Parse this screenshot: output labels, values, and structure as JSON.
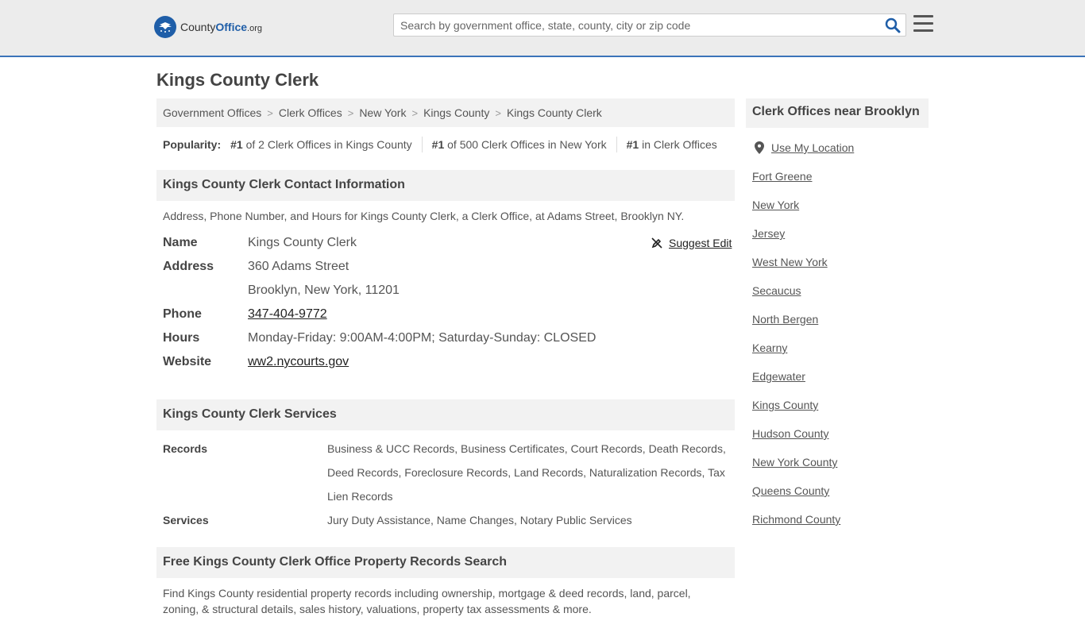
{
  "header": {
    "logo_county": "County",
    "logo_office": "Office",
    "logo_org": ".org",
    "search_placeholder": "Search by government office, state, county, city or zip code"
  },
  "page_title": "Kings County Clerk",
  "breadcrumb": [
    "Government Offices",
    "Clerk Offices",
    "New York",
    "Kings County",
    "Kings County Clerk"
  ],
  "popularity": {
    "label": "Popularity:",
    "items": [
      {
        "rank": "#1",
        "text": " of 2 Clerk Offices in Kings County"
      },
      {
        "rank": "#1",
        "text": " of 500 Clerk Offices in New York"
      },
      {
        "rank": "#1",
        "text": " in Clerk Offices"
      }
    ]
  },
  "contact": {
    "heading": "Kings County Clerk Contact Information",
    "description": "Address, Phone Number, and Hours for Kings County Clerk, a Clerk Office, at Adams Street, Brooklyn NY.",
    "name_label": "Name",
    "name": "Kings County Clerk",
    "address_label": "Address",
    "address_line1": "360 Adams Street",
    "address_line2": "Brooklyn, New York, 11201",
    "phone_label": "Phone",
    "phone": "347-404-9772",
    "hours_label": "Hours",
    "hours": "Monday-Friday: 9:00AM-4:00PM; Saturday-Sunday: CLOSED",
    "website_label": "Website",
    "website": "ww2.nycourts.gov",
    "suggest_edit": "Suggest Edit"
  },
  "services": {
    "heading": "Kings County Clerk Services",
    "records_label": "Records",
    "records": "Business & UCC Records, Business Certificates, Court Records, Death Records, Deed Records, Foreclosure Records, Land Records, Naturalization Records, Tax Lien Records",
    "services_label": "Services",
    "services": "Jury Duty Assistance, Name Changes, Notary Public Services"
  },
  "property": {
    "heading": "Free Kings County Clerk Office Property Records Search",
    "description": "Find Kings County residential property records including ownership, mortgage & deed records, land, parcel, zoning, & structural details, sales history, valuations, property tax assessments & more."
  },
  "sidebar": {
    "heading": "Clerk Offices near Brooklyn",
    "use_location": "Use My Location",
    "links": [
      "Fort Greene",
      "New York",
      "Jersey",
      "West New York",
      "Secaucus",
      "North Bergen",
      "Kearny",
      "Edgewater",
      "Kings County",
      "Hudson County",
      "New York County",
      "Queens County",
      "Richmond County"
    ]
  },
  "colors": {
    "accent": "#3b73b9",
    "logo_blue": "#1f5ea8",
    "panel_bg": "#f2f2f2"
  }
}
